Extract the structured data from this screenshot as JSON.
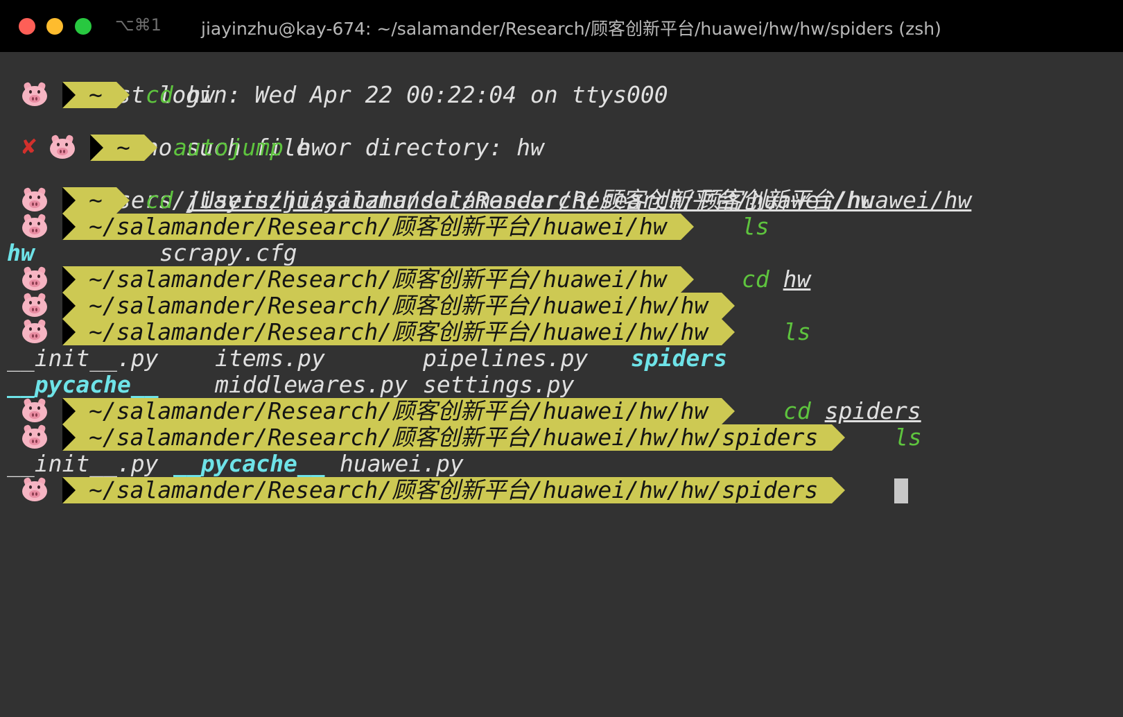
{
  "titlebar": {
    "shortcut": "⌥⌘1",
    "title": "jiayinzhu@kay-674: ~/salamander/Research/顾客创新平台/huawei/hw/hw/spiders (zsh)"
  },
  "colors": {
    "background": "#323232",
    "prompt_segment": "#cdc953",
    "command": "#5ec43e",
    "directory": "#6ee3e8",
    "error_mark": "#d2302c"
  },
  "icons": {
    "prompt_icon": "pig-face-icon",
    "error_icon": "cross-mark-icon"
  },
  "lines": {
    "login": "Last login: Wed Apr 22 00:22:04 on ttys000",
    "p1": {
      "path": "~",
      "cmd": "cd",
      "arg": "hw"
    },
    "err1": "cd: no such file or directory: hw",
    "p2": {
      "error_mark": "✘",
      "path": "~",
      "cmd": "autojump",
      "arg": "hw"
    },
    "out2": "/Users/jiayinzhu/salamander/Research/顾客创新平台/huawei/hw",
    "p3": {
      "path": "~",
      "cmd": "cd",
      "arg": "/Users/jiayinzhu/salamander/Research/顾客创新平台/huawei/hw"
    },
    "p4": {
      "path": "~/salamander/Research/顾客创新平台/huawei/hw",
      "cmd": "ls"
    },
    "ls1": {
      "dir": "hw",
      "file": "scrapy.cfg"
    },
    "p5": {
      "path": "~/salamander/Research/顾客创新平台/huawei/hw",
      "cmd": "cd",
      "arg": "hw"
    },
    "p6": {
      "path": "~/salamander/Research/顾客创新平台/huawei/hw/hw"
    },
    "p7": {
      "path": "~/salamander/Research/顾客创新平台/huawei/hw/hw",
      "cmd": "ls"
    },
    "ls2a": {
      "f1": "__init__.py",
      "f2": "items.py",
      "f3": "pipelines.py",
      "dir": "spiders"
    },
    "ls2b": {
      "dir": "__pycache__",
      "f1": "middlewares.py",
      "f2": "settings.py"
    },
    "p8": {
      "path": "~/salamander/Research/顾客创新平台/huawei/hw/hw",
      "cmd": "cd",
      "arg": "spiders"
    },
    "p9": {
      "path": "~/salamander/Research/顾客创新平台/huawei/hw/hw/spiders",
      "cmd": "ls"
    },
    "ls3": {
      "f1": "__init__.py",
      "dir": "__pycache__",
      "f2": "huawei.py"
    },
    "p10": {
      "path": "~/salamander/Research/顾客创新平台/huawei/hw/hw/spiders"
    }
  }
}
